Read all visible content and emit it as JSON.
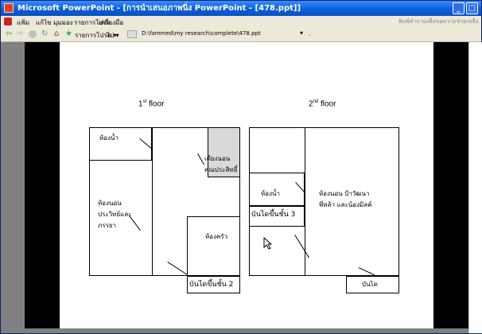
{
  "window": {
    "title": "Microsoft PowerPoint - [การนำเสนอภาพนิ่ง PowerPoint - [478.ppt]]",
    "min_label": "_",
    "max_label": "□"
  },
  "menubar": {
    "file": "แฟ้ม",
    "edit": "แก้ไข",
    "view": "มุมมอง",
    "favorites": "รายการโปรด",
    "tools": "เครื่องมือ",
    "search_hint": "พิมพ์คำถามเพื่อขอความช่วยเหลือ"
  },
  "toolbar": {
    "back": "⇦",
    "forward": "⇨",
    "refresh": "↻",
    "home": "⌂",
    "favorites_icon": "★",
    "favorites_label": "รายการโปรด ▾",
    "tools_label": "ไป ▾",
    "address": "D:\\fammed\\my research\\complete\\478.ppt",
    "address_dropdown": "▾",
    "address_dot": "."
  },
  "slide": {
    "floor1_title": {
      "num": "1",
      "sup": "st",
      "word": "floor"
    },
    "floor2_title": {
      "num": "2",
      "sup": "nd",
      "word": "floor"
    },
    "floor1": {
      "bathroom": "ห้องน้ำ",
      "bedroom_parents": "ห้องนอน\nประวิทย์และ\nภรรยา",
      "bed_area": "เตียงนอน\nคุณประสิทธิ์",
      "kitchen": "ห้องครัว",
      "stairs_2": "บันไดขึ้นชั้น 2"
    },
    "floor2": {
      "bathroom": "ห้องน้ำ",
      "bedroom": "ห้องนอน ป้าวัฒนา\nพี่หล้า และน้องมิลค์",
      "stairs_3": "บันไดขึ้นชั้น 3",
      "stairs": "บันได"
    }
  },
  "colors": {
    "title_blue": "#0a5fd8",
    "shaded_room": "#d9d9d9",
    "frame_black": "#000000"
  }
}
